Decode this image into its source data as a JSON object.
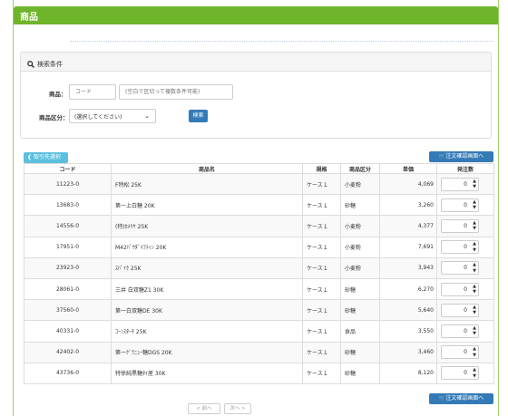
{
  "header": {
    "title": "商品"
  },
  "search": {
    "title": "検索条件",
    "product_label": "商品：",
    "code_placeholder": "コード",
    "name_placeholder": "(空白で区切って複数条件可能)",
    "category_label": "商品区分：",
    "category_selected": "(選択してください)",
    "search_button": "検索"
  },
  "toolbar": {
    "back_label": "取引先選択",
    "order_confirm_label": "注文確認画面へ"
  },
  "table": {
    "headers": [
      "コード",
      "商品名",
      "規格",
      "商品区分",
      "単価",
      "発注数"
    ],
    "rows": [
      {
        "code": "11223-0",
        "name": "F特松 25K",
        "spec": "ケース１",
        "category": "小麦粉",
        "price": "4,069",
        "qty": "0"
      },
      {
        "code": "13683-0",
        "name": "第一上白糖 20K",
        "spec": "ケース１",
        "category": "砂糖",
        "price": "3,260",
        "qty": "0"
      },
      {
        "code": "14556-0",
        "name": "(特)ｶﾒﾘﾔ 25K",
        "spec": "ケース１",
        "category": "小麦粉",
        "price": "4,377",
        "qty": "0"
      },
      {
        "code": "17951-0",
        "name": "M42ﾊﾟｳﾀﾞｲﾌﾃｨﾝ 20K",
        "spec": "ケース１",
        "category": "小麦粉",
        "price": "7,691",
        "qty": "0"
      },
      {
        "code": "23923-0",
        "name": "ｽﾊﾟｲｸ 25K",
        "spec": "ケース１",
        "category": "小麦粉",
        "price": "3,943",
        "qty": "0"
      },
      {
        "code": "28061-0",
        "name": "三井 白双糖Z1 30K",
        "spec": "ケース１",
        "category": "砂糖",
        "price": "6,270",
        "qty": "0"
      },
      {
        "code": "37560-0",
        "name": "第一白双糖DE 30K",
        "spec": "ケース１",
        "category": "砂糖",
        "price": "5,640",
        "qty": "0"
      },
      {
        "code": "40331-0",
        "name": "ｺｰﾝｽﾀｰﾁ 25K",
        "spec": "ケース１",
        "category": "食品",
        "price": "3,550",
        "qty": "0"
      },
      {
        "code": "42402-0",
        "name": "第一ｸﾞﾗﾆｭｰ糖DGS 20K",
        "spec": "ケース１",
        "category": "砂糖",
        "price": "3,460",
        "qty": "0"
      },
      {
        "code": "43736-0",
        "name": "特徐純黒糖ﾀｲ産 30K",
        "spec": "ケース１",
        "category": "砂糖",
        "price": "8,120",
        "qty": "0"
      }
    ]
  },
  "pager": {
    "prev": "< 前へ",
    "next": "次へ >"
  },
  "colors": {
    "header": "#6fb52c",
    "primary": "#337ab7",
    "info": "#5bc0de"
  },
  "icons": {
    "search": "magnifier-icon",
    "cart": "cart-icon",
    "back": "chevron-left-icon"
  }
}
